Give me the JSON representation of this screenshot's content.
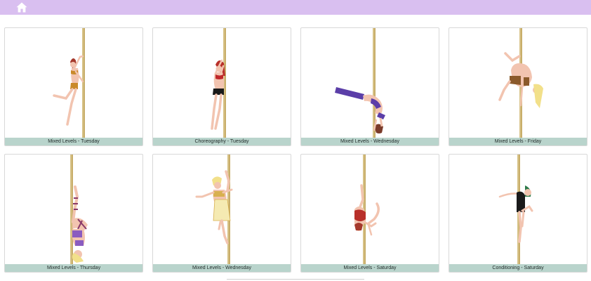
{
  "header": {
    "home_icon": "home-icon",
    "accent_color": "#d9bff0"
  },
  "classes": [
    {
      "label": "Mixed Levels - Tuesday"
    },
    {
      "label": "Choreography - Tuesday"
    },
    {
      "label": "Mixed Levels - Wednesday"
    },
    {
      "label": "Mixed Levels - Friday"
    },
    {
      "label": "Mixed Levels - Thursday"
    },
    {
      "label": "Mixed Levels - Wednesday"
    },
    {
      "label": "Mixed Levels - Saturday"
    },
    {
      "label": "Conditioning - Saturday"
    }
  ],
  "caption_color": "#b9d4cc",
  "pole_color": "#c8ae6a"
}
